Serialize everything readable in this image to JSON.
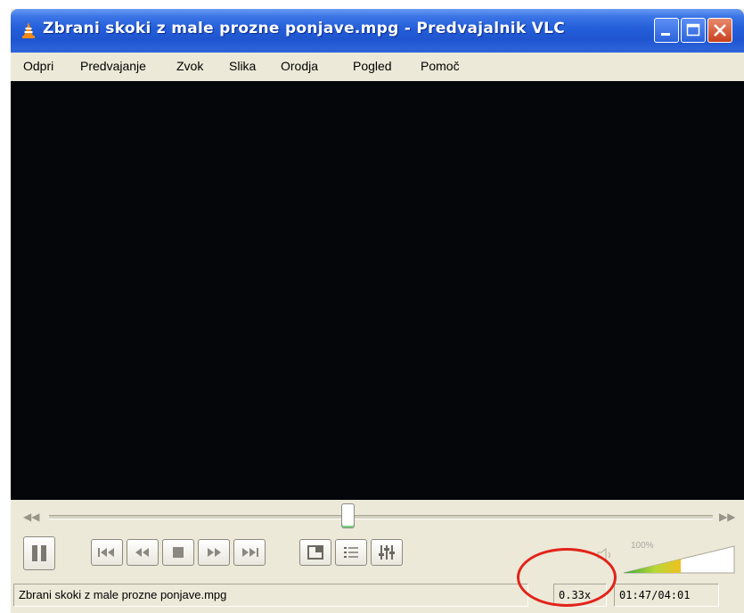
{
  "window": {
    "title": "Zbrani skoki z male prozne ponjave.mpg - Predvajalnik VLC",
    "app_icon": "vlc-cone-icon",
    "buttons": [
      "minimize-icon",
      "maximize-icon",
      "close-icon"
    ]
  },
  "menu": {
    "items": [
      "Odpri",
      "Predvajanje",
      "Zvok",
      "Slika",
      "Orodja",
      "Pogled",
      "Pomoč"
    ]
  },
  "player": {
    "video_background": "#040609",
    "seek_position_fraction": 0.45,
    "volume": {
      "label": "100%",
      "level_fraction": 0.5,
      "icon": "speaker-icon"
    },
    "control_icons": [
      "pause-icon",
      "previous-icon",
      "rewind-icon",
      "stop-icon",
      "fast-forward-icon",
      "next-icon",
      "fullscreen-icon",
      "playlist-icon",
      "equalizer-icon"
    ]
  },
  "statusbar": {
    "filename": "Zbrani skoki z male prozne ponjave.mpg",
    "speed": "0.33x",
    "time": "01:47/04:01"
  },
  "annotation": {
    "highlight_color": "#e2231a"
  }
}
